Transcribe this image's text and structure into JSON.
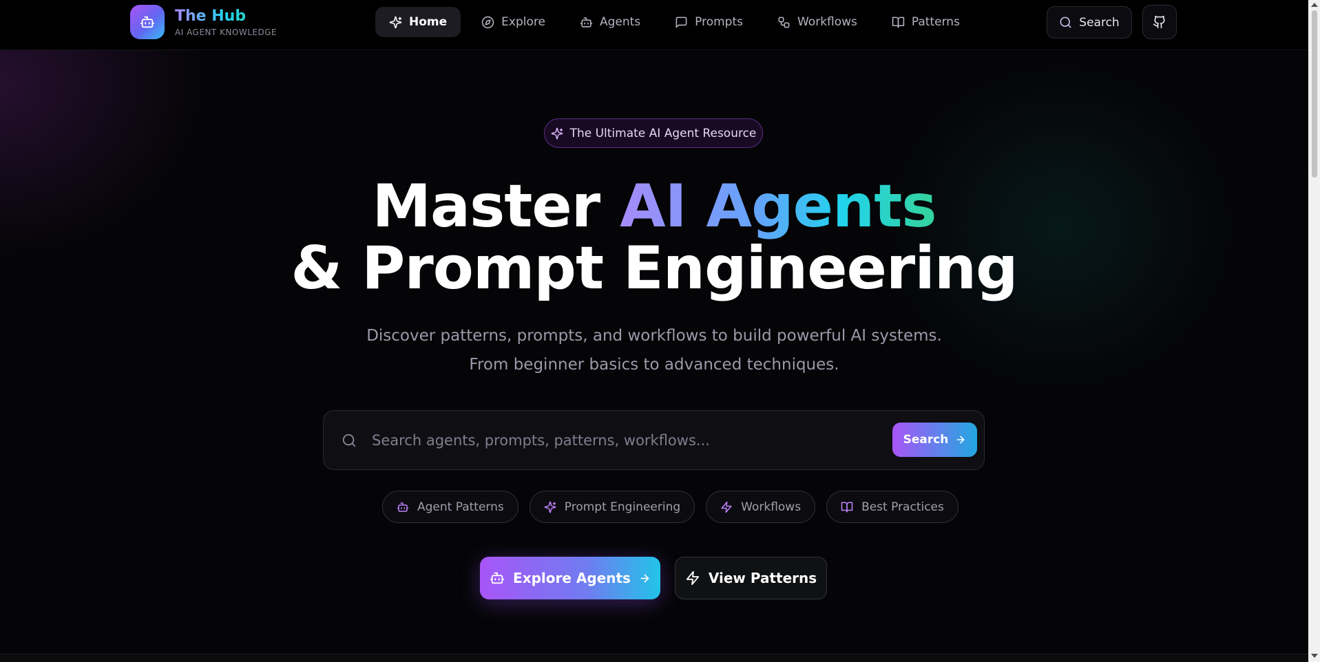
{
  "header": {
    "logo_title": "The Hub",
    "logo_subtitle": "AI AGENT KNOWLEDGE",
    "logo_icon": "bot-icon",
    "nav": [
      {
        "label": "Home",
        "icon": "sparkles-icon",
        "active": true
      },
      {
        "label": "Explore",
        "icon": "compass-icon"
      },
      {
        "label": "Agents",
        "icon": "bot-icon"
      },
      {
        "label": "Prompts",
        "icon": "message-square-icon"
      },
      {
        "label": "Workflows",
        "icon": "workflow-icon"
      },
      {
        "label": "Patterns",
        "icon": "book-open-icon"
      }
    ],
    "search_label": "Search",
    "github_icon": "github-icon"
  },
  "hero": {
    "badge": "The Ultimate AI Agent Resource",
    "headline_line1_plain": "Master ",
    "headline_line1_gradient": "AI Agents",
    "headline_line2": "& Prompt Engineering",
    "subtitle_line1": "Discover patterns, prompts, and workflows to build powerful AI systems.",
    "subtitle_line2": "From beginner basics to advanced techniques.",
    "search": {
      "placeholder": "Search agents, prompts, patterns, workflows...",
      "value": "",
      "button_label": "Search"
    },
    "tags": [
      {
        "label": "Agent Patterns",
        "icon": "bot-icon"
      },
      {
        "label": "Prompt Engineering",
        "icon": "sparkles-icon"
      },
      {
        "label": "Workflows",
        "icon": "zap-icon"
      },
      {
        "label": "Best Practices",
        "icon": "book-open-icon"
      }
    ],
    "cta_primary": "Explore Agents",
    "cta_secondary": "View Patterns"
  },
  "colors": {
    "accent_purple": "#a855f7",
    "accent_cyan": "#22d3ee",
    "accent_green": "#34d399",
    "background": "#050507"
  }
}
